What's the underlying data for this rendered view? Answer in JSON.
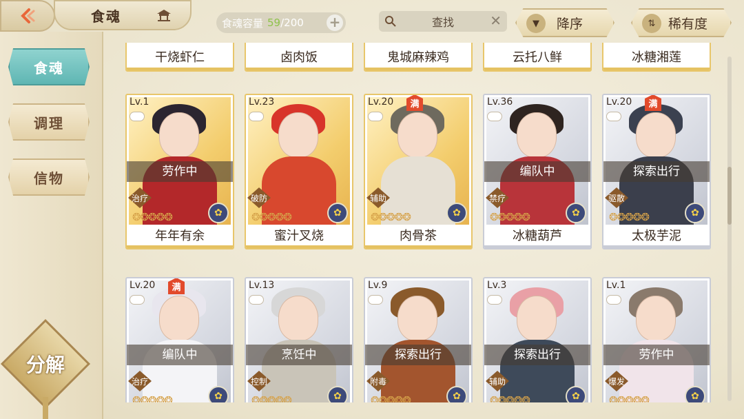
{
  "header": {
    "title": "食魂",
    "capacity_label": "食魂容量",
    "capacity_current": "59",
    "capacity_max": "/200",
    "search_placeholder": "查找",
    "sort_label": "降序",
    "rarity_label": "稀有度"
  },
  "sidebar": {
    "items": [
      {
        "label": "食魂",
        "active": true
      },
      {
        "label": "调理",
        "active": false
      },
      {
        "label": "信物",
        "active": false
      }
    ],
    "decompose_label": "分解"
  },
  "top_row": [
    "干烧虾仁",
    "卤肉饭",
    "鬼城麻辣鸡",
    "云托八鲜",
    "冰糖湘莲"
  ],
  "cards": [
    {
      "lv": "Lv.1",
      "full": false,
      "status": "劳作中",
      "role": "治疗",
      "name": "年年有余",
      "rarity": "gold",
      "stars": 5,
      "lit": 5
    },
    {
      "lv": "Lv.23",
      "full": false,
      "status": "",
      "role": "破防",
      "name": "蜜汁叉烧",
      "rarity": "gold",
      "stars": 5,
      "lit": 5
    },
    {
      "lv": "Lv.20",
      "full": true,
      "full_label": "满",
      "status": "",
      "role": "辅助",
      "name": "肉骨茶",
      "rarity": "gold",
      "stars": 5,
      "lit": 5
    },
    {
      "lv": "Lv.36",
      "full": false,
      "status": "编队中",
      "role": "禁疗",
      "name": "冰糖葫芦",
      "rarity": "silver",
      "stars": 5,
      "lit": 5
    },
    {
      "lv": "Lv.20",
      "full": true,
      "full_label": "满",
      "status": "探索出行",
      "role": "驱散",
      "name": "太极芋泥",
      "rarity": "silver",
      "stars": 5,
      "lit": 5
    },
    {
      "lv": "Lv.20",
      "full": true,
      "full_label": "满",
      "status": "编队中",
      "role": "治疗",
      "name": "",
      "rarity": "silver",
      "stars": 5,
      "lit": 5
    },
    {
      "lv": "Lv.13",
      "full": false,
      "status": "烹饪中",
      "role": "控制",
      "name": "",
      "rarity": "silver",
      "stars": 5,
      "lit": 5
    },
    {
      "lv": "Lv.9",
      "full": false,
      "status": "探索出行",
      "role": "附毒",
      "name": "",
      "rarity": "silver",
      "stars": 5,
      "lit": 5
    },
    {
      "lv": "Lv.3",
      "full": false,
      "status": "探索出行",
      "role": "辅助",
      "name": "",
      "rarity": "silver",
      "stars": 5,
      "lit": 5
    },
    {
      "lv": "Lv.1",
      "full": false,
      "status": "劳作中",
      "role": "爆发",
      "name": "",
      "rarity": "silver",
      "stars": 5,
      "lit": 5
    }
  ],
  "colors": {
    "accent_teal": "#5fb6b3",
    "gold_frame": "#e8c66a",
    "silver_frame": "#c9ccd6",
    "capacity_green": "#8ec24b",
    "full_badge": "#e24a2c"
  },
  "icons": {
    "back": "back-arrow-icon",
    "title": "pavilion-icon",
    "capacity_add": "plus-icon",
    "search": "search-icon",
    "clear": "close-icon",
    "sort": "triangle-down-icon",
    "rarity": "sort-arrows-icon"
  }
}
